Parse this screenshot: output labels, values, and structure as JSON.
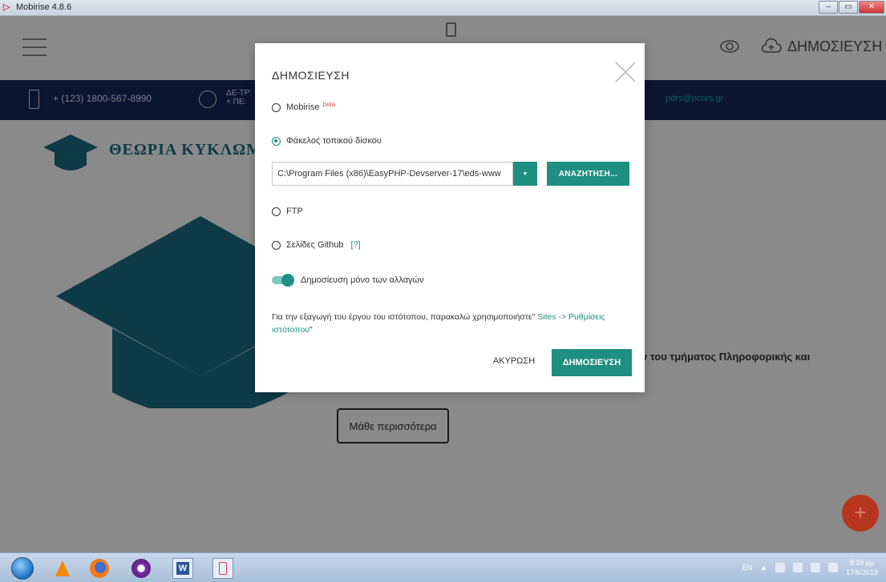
{
  "window": {
    "title": "Mobirise 4.8.6",
    "minimize": "–",
    "maximize": "▭",
    "close": "✕"
  },
  "editor_bar": {
    "publish_label": "ΔΗΜΟΣΙΕΥΣΗ"
  },
  "contact_bar": {
    "phone": "+ (123) 1800-567-8990",
    "hours_line1": "ΔΕ-ΤΡ:",
    "hours_line2": "+ ΠΕ:",
    "email": "pdrs@pcors.gr"
  },
  "page": {
    "logo_text": "ΘΕΩΡΙΑ ΚΥΚΛΩΜ",
    "hero_text": "ν του τμήματος Πληροφορικής και",
    "learn_more": "Μάθε περισσότερα",
    "fab_label": "+"
  },
  "modal": {
    "title": "ΔΗΜΟΣΙΕΥΣΗ",
    "option_mobirise": "Mobirise",
    "option_mobirise_badge": "beta",
    "option_local": "Φάκελος τοπικού δίσκου",
    "path_value": "C:\\Program Files (x86)\\EasyPHP-Devserver-17\\eds-www",
    "browse_label": "ΑΝΑΖΗΤΗΣΗ...",
    "option_ftp": "FTP",
    "option_github": "Σελίδες Github",
    "github_help": "[?]",
    "toggle_label": "Δημοσίευση μόνο των αλλαγών",
    "note_text": "Για την εξαγωγή του έργου του ιστότοπου, παρακαλώ χρησιμοποιήστε\"",
    "note_link": "Sites -> Ρυθμίσεις ιστότοπου",
    "note_end": "\"",
    "cancel_label": "ΑΚΥΡΩΣΗ",
    "publish_label": "ΔΗΜΟΣΙΕΥΣΗ"
  },
  "taskbar": {
    "lang": "EN",
    "time": "8:39 μμ",
    "date": "17/6/2019"
  },
  "colors": {
    "accent": "#1f8f82",
    "contact_bg": "#0a1630",
    "overlay": "#8a8a8a",
    "fab": "#b7361f"
  }
}
